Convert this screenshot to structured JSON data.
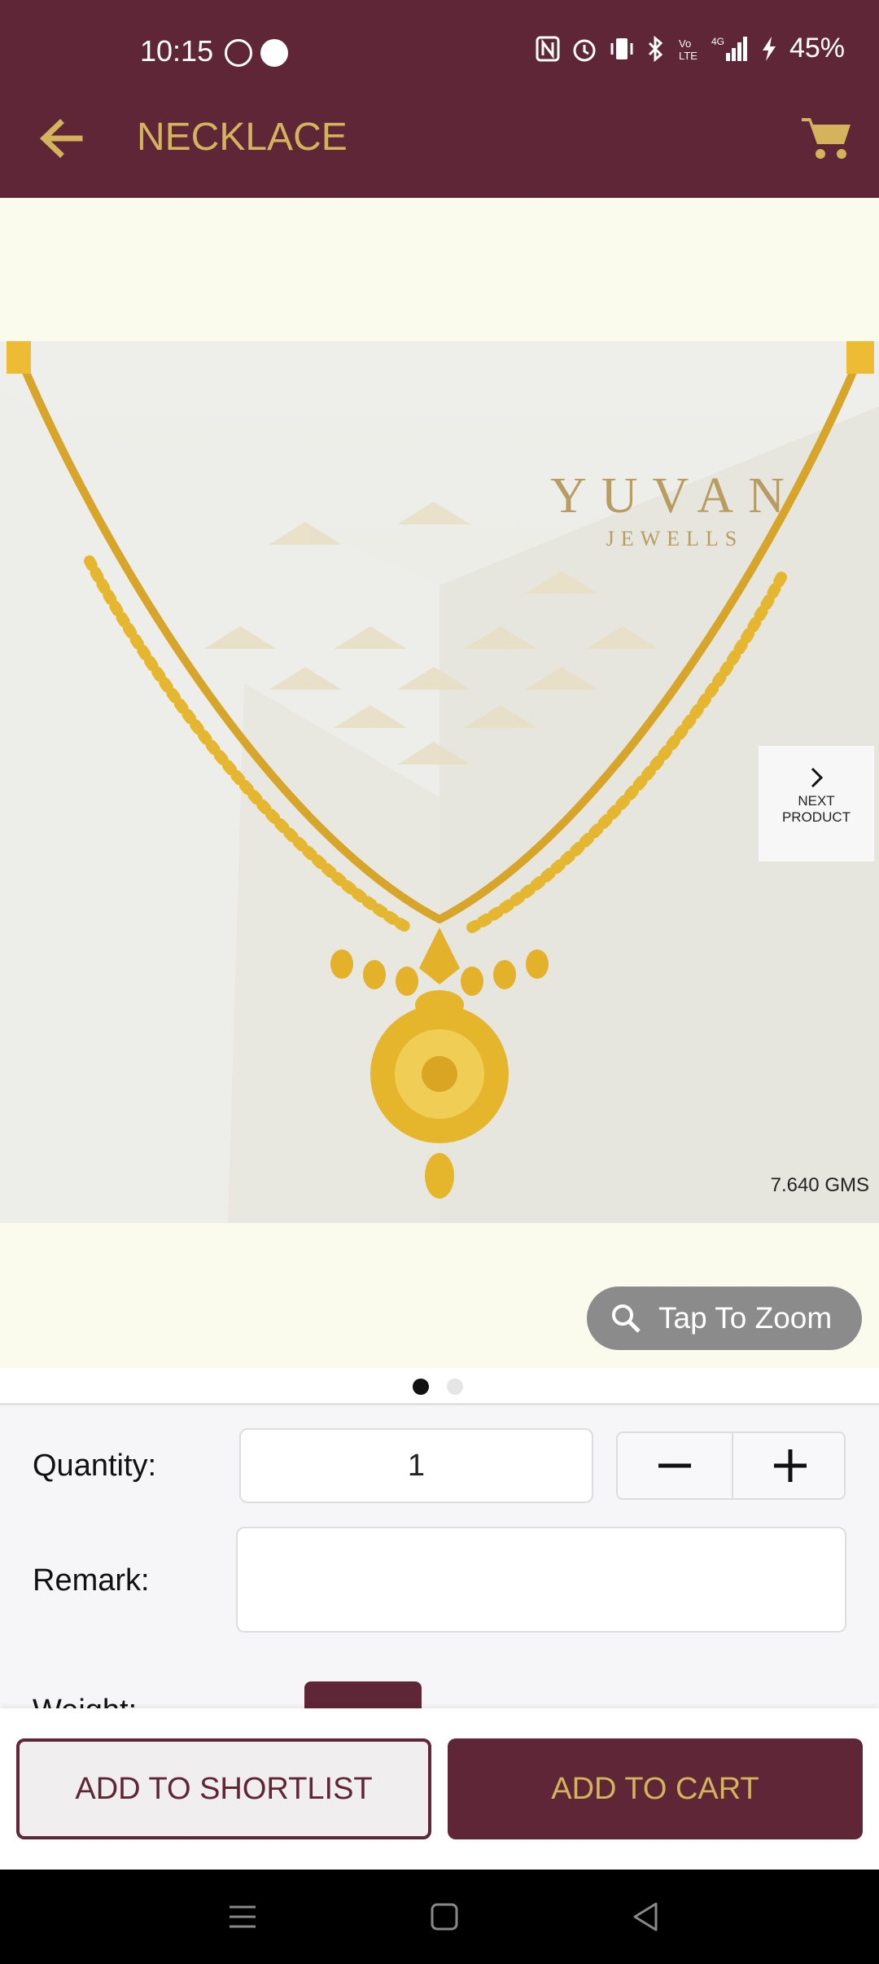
{
  "status_bar": {
    "time": "10:15",
    "battery": "45%",
    "icons": [
      "whatsapp-icon",
      "message-icon",
      "nfc-icon",
      "alarm-icon",
      "vibrate-icon",
      "bluetooth-icon",
      "volte-icon",
      "signal-icon",
      "charging-icon"
    ]
  },
  "app_bar": {
    "title": "NECKLACE",
    "accent_color": "#5e2636",
    "title_color": "#d4b35c"
  },
  "gallery": {
    "brand_name": "YUVAN",
    "brand_sub": "JEWELLS",
    "weight": "7.640  GMS",
    "next_label_1": "NEXT",
    "next_label_2": "PRODUCT",
    "zoom_label": "Tap To Zoom",
    "page_count": 2,
    "current_page": 1
  },
  "form": {
    "quantity_label": "Quantity:",
    "quantity_value": "1",
    "remark_label": "Remark:",
    "remark_value": "",
    "weight_label": "Weight:"
  },
  "actions": {
    "shortlist_label": "ADD TO SHORTLIST",
    "cart_label": "ADD TO CART"
  }
}
